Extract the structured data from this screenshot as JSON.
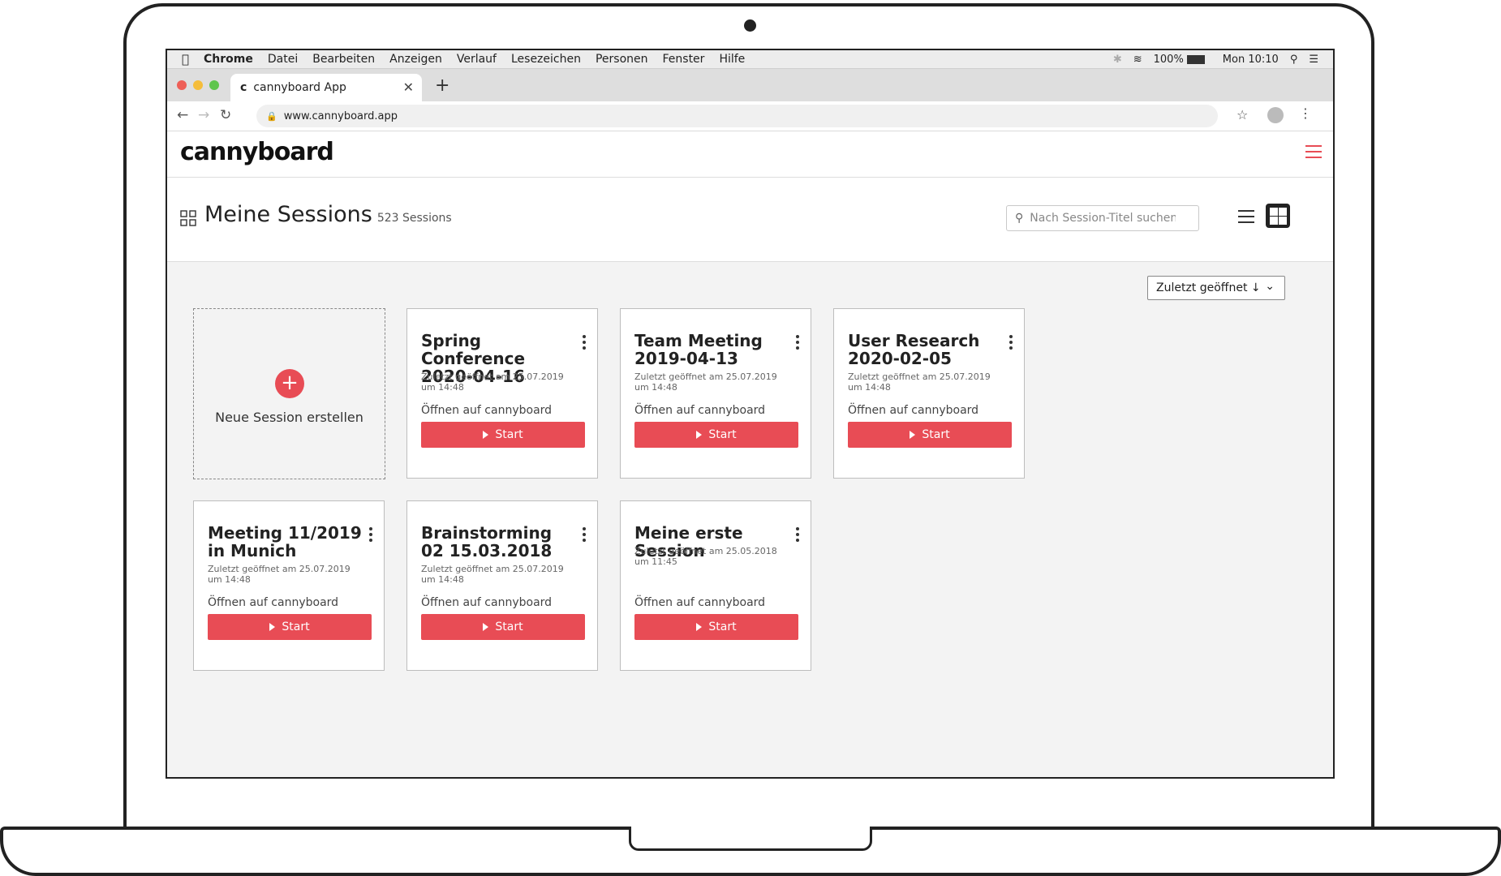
{
  "menubar": {
    "app": "Chrome",
    "items": [
      "Datei",
      "Bearbeiten",
      "Anzeigen",
      "Verlauf",
      "Lesezeichen",
      "Personen",
      "Fenster",
      "Hilfe"
    ],
    "battery": "100%",
    "clock": "Mon 10:10"
  },
  "browser": {
    "tab_title": "cannyboard App",
    "favicon": "c",
    "url": "www.cannyboard.app"
  },
  "app": {
    "logo": "cannyboard",
    "page_title": "Meine Sessions",
    "session_count": "523 Sessions",
    "search_placeholder": "Nach Session-Titel suchen...",
    "sort_label": "Zuletzt geöffnet ↓",
    "new_session_label": "Neue Session erstellen"
  },
  "sessions": [
    {
      "title": "Spring Conference 2020-04-16",
      "meta": "Zuletzt geöffnet am 25.07.2019 um 14:48",
      "open": "Öffnen auf cannyboard",
      "start": "Start"
    },
    {
      "title": "Team Meeting 2019-04-13",
      "meta": "Zuletzt geöffnet am 25.07.2019 um 14:48",
      "open": "Öffnen auf cannyboard",
      "start": "Start"
    },
    {
      "title": "User Research 2020-02-05",
      "meta": "Zuletzt geöffnet am 25.07.2019 um 14:48",
      "open": "Öffnen auf cannyboard",
      "start": "Start"
    },
    {
      "title": "Meeting 11/2019 in Munich",
      "meta": "Zuletzt geöffnet am 25.07.2019 um 14:48",
      "open": "Öffnen auf cannyboard",
      "start": "Start"
    },
    {
      "title": "Brainstorming 02 15.03.2018",
      "meta": "Zuletzt geöffnet am 25.07.2019 um 14:48",
      "open": "Öffnen auf cannyboard",
      "start": "Start"
    },
    {
      "title": "Meine erste Session",
      "meta": "Zuletzt geöffnet am 25.05.2018 um 11:45",
      "open": "Öffnen auf cannyboard",
      "start": "Start"
    }
  ],
  "colors": {
    "accent": "#e84c55",
    "dark": "#222222"
  }
}
